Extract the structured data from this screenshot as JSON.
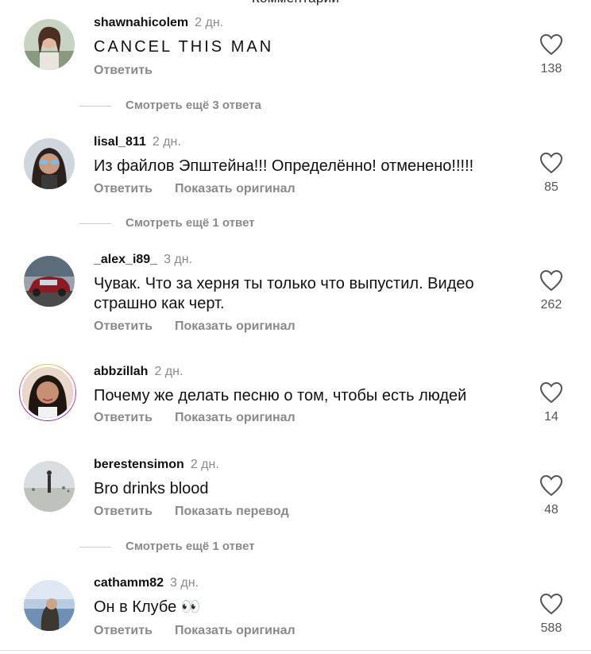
{
  "header": {
    "title": "Комментарии"
  },
  "comments": [
    {
      "username": "shawnahicolem",
      "time": "2 дн.",
      "text": "CANCEL THIS MAN",
      "reply": "Ответить",
      "second_action": "",
      "likes": "138",
      "more_replies": "Смотреть ещё 3 ответа"
    },
    {
      "username": "lisal_811",
      "time": "2 дн.",
      "text": "Из файлов Эпштейна!!! Определённо! отменено!!!!!",
      "reply": "Ответить",
      "second_action": "Показать оригинал",
      "likes": "85",
      "more_replies": "Смотреть ещё 1 ответ"
    },
    {
      "username": "_alex_i89_",
      "time": "3 дн.",
      "text": "Чувак. Что за херня ты только что выпустил. Видео страшно как черт.",
      "reply": "Ответить",
      "second_action": "Показать оригинал",
      "likes": "262",
      "more_replies": ""
    },
    {
      "username": "abbzillah",
      "time": "2 дн.",
      "text": "Почему же делать песню о том, чтобы есть людей",
      "reply": "Ответить",
      "second_action": "Показать оригинал",
      "likes": "14",
      "more_replies": ""
    },
    {
      "username": "berestensimon",
      "time": "2 дн.",
      "text": "Bro drinks blood",
      "reply": "Ответить",
      "second_action": "Показать перевод",
      "likes": "48",
      "more_replies": "Смотреть ещё 1 ответ"
    },
    {
      "username": "cathamm82",
      "time": "3 дн.",
      "text": "Он в Клубе 👀",
      "reply": "Ответить",
      "second_action": "Показать оригинал",
      "likes": "588",
      "more_replies": ""
    }
  ],
  "icons": {
    "like": "heart-outline-icon"
  },
  "colors": {
    "muted": "#8a8a8a",
    "text": "#111111",
    "story_ring": "#ee2a7b"
  }
}
